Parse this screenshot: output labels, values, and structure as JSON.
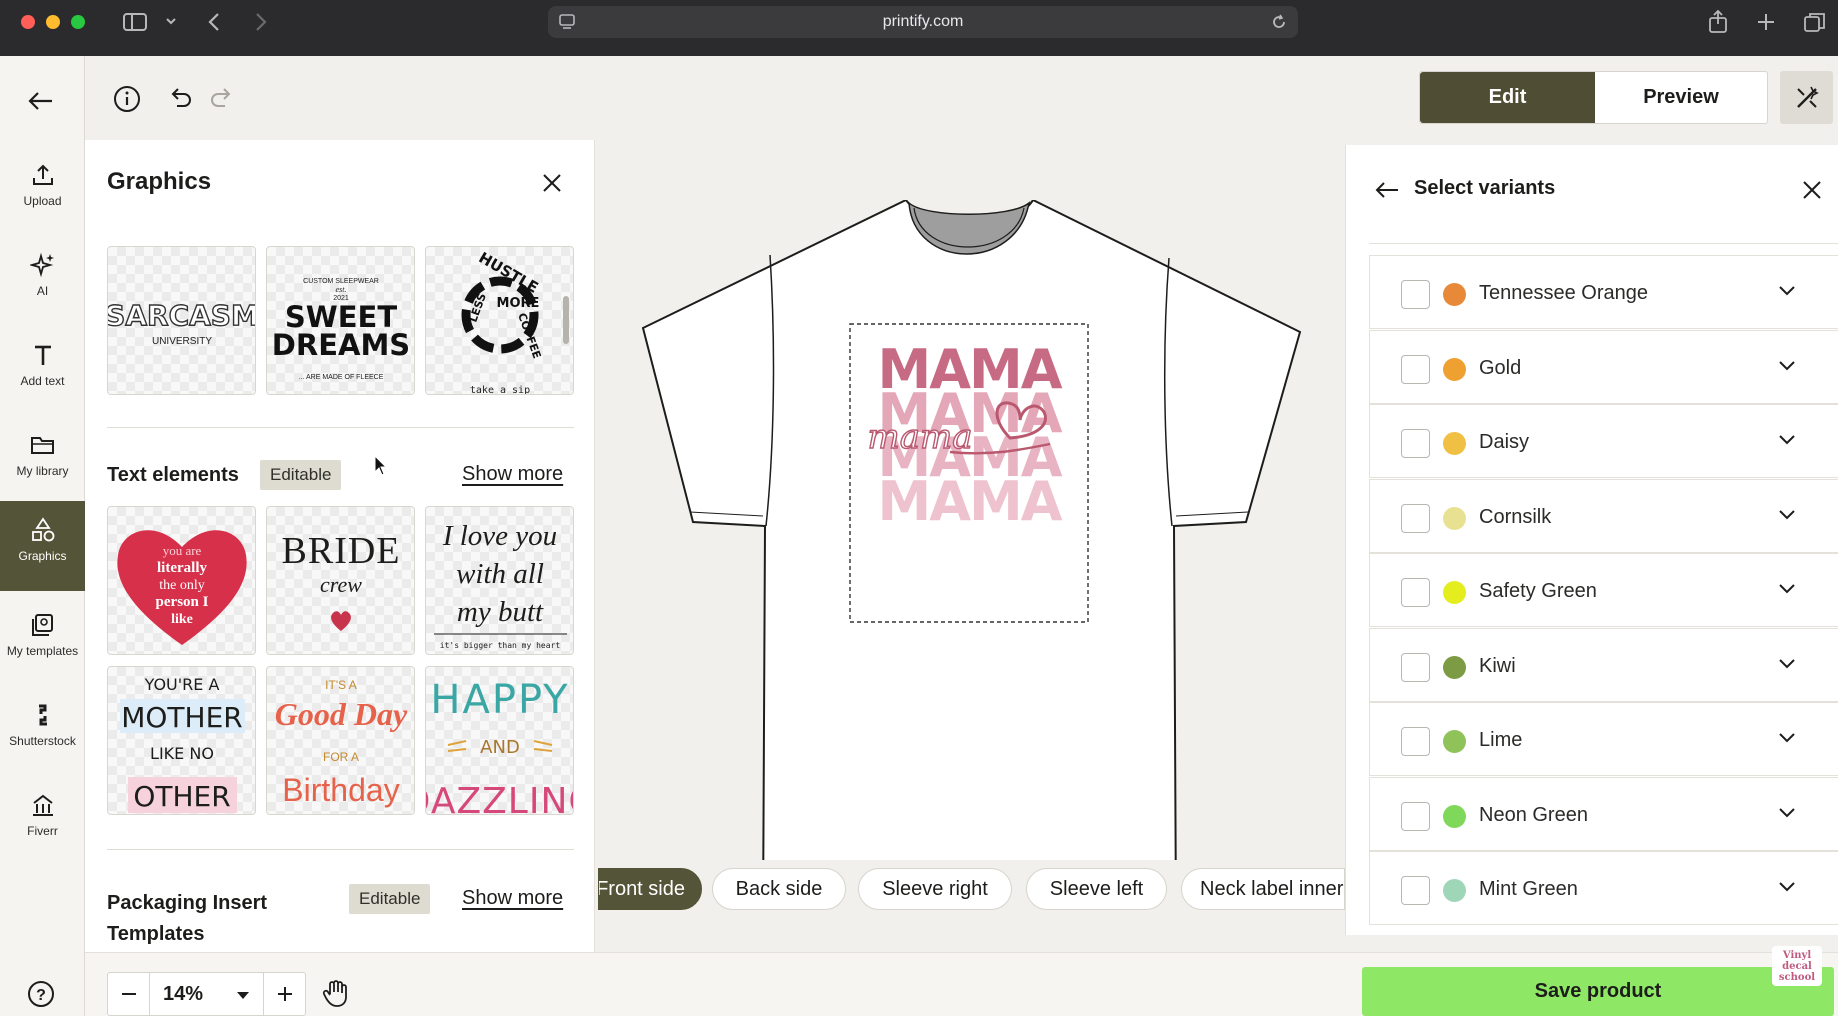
{
  "browser": {
    "url": "printify.com"
  },
  "rail": {
    "items": [
      {
        "label": "Upload",
        "icon": "upload-icon"
      },
      {
        "label": "AI",
        "icon": "sparkles-icon"
      },
      {
        "label": "Add text",
        "icon": "text-icon"
      },
      {
        "label": "My library",
        "icon": "folder-icon"
      },
      {
        "label": "Graphics",
        "icon": "shapes-icon",
        "active": true
      },
      {
        "label": "My templates",
        "icon": "templates-icon"
      },
      {
        "label": "Shutterstock",
        "icon": "shutterstock-icon"
      },
      {
        "label": "Fiverr",
        "icon": "fiverr-icon"
      }
    ]
  },
  "toolbar": {
    "edit_label": "Edit",
    "preview_label": "Preview"
  },
  "graphics": {
    "title": "Graphics",
    "top_thumbs": [
      {
        "line1": "SARCASM",
        "line2": "UNIVERSITY"
      },
      {
        "line1": "CUSTOM SLEEPWEAR",
        "line2": "est.",
        "line3": "2021",
        "line4": "SWEET",
        "line5": "DREAMS",
        "line6": "... ARE MADE OF FLEECE"
      },
      {
        "line1": "HUSTLE",
        "line2": "MORE",
        "line3": "COFFEE",
        "line4": "LESS",
        "line5": "take a sip"
      }
    ],
    "text_elements": {
      "title": "Text elements",
      "tag": "Editable",
      "show_more": "Show more",
      "items": [
        {
          "lines": [
            "you are",
            "literally",
            "the only",
            "person I",
            "like"
          ]
        },
        {
          "lines": [
            "BRIDE",
            "crew"
          ]
        },
        {
          "lines": [
            "I love you",
            "with all",
            "my butt",
            "it's bigger than my heart"
          ]
        },
        {
          "lines": [
            "YOU'RE A",
            "MOTHER",
            "LIKE NO",
            "OTHER"
          ]
        },
        {
          "lines": [
            "IT'S A",
            "Good Day",
            "FOR A",
            "Birthday"
          ]
        },
        {
          "lines": [
            "HAPPY",
            "AND",
            "DAZZLING"
          ]
        }
      ]
    },
    "packaging": {
      "title_line1": "Packaging Insert",
      "title_line2": "Templates",
      "tag": "Editable",
      "show_more": "Show more"
    }
  },
  "design": {
    "word": "MAMA",
    "script": "mama"
  },
  "sides": [
    "Front side",
    "Back side",
    "Sleeve right",
    "Sleeve left",
    "Neck label inner"
  ],
  "variants": {
    "title": "Select variants",
    "colors": [
      {
        "name": "Tennessee Orange",
        "color": "#e8893a"
      },
      {
        "name": "Gold",
        "color": "#eea031"
      },
      {
        "name": "Daisy",
        "color": "#f0c044"
      },
      {
        "name": "Cornsilk",
        "color": "#e9e192"
      },
      {
        "name": "Safety Green",
        "color": "#e4ee1f"
      },
      {
        "name": "Kiwi",
        "color": "#7d9a44"
      },
      {
        "name": "Lime",
        "color": "#8fc35a"
      },
      {
        "name": "Neon Green",
        "color": "#7fd85a"
      },
      {
        "name": "Mint Green",
        "color": "#9fd6b8"
      }
    ]
  },
  "bottom": {
    "zoom": "14%",
    "save_label": "Save product"
  },
  "watermark": {
    "line1": "Vinyl",
    "line2": "decal",
    "line3": "school"
  }
}
